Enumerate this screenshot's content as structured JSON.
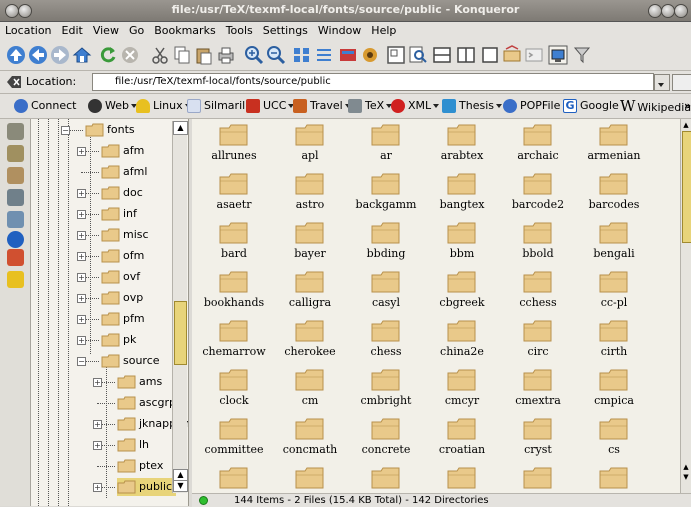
{
  "window": {
    "title": "file:/usr/TeX/texmf-local/fonts/source/public - Konqueror"
  },
  "menu": [
    "Location",
    "Edit",
    "View",
    "Go",
    "Bookmarks",
    "Tools",
    "Settings",
    "Window",
    "Help"
  ],
  "location": {
    "label": "Location:",
    "url": "file:/usr/TeX/texmf-local/fonts/source/public"
  },
  "bookmarks": [
    {
      "label": "Connect",
      "color": "#3a6ec8",
      "dropdown": false
    },
    {
      "label": "Web",
      "color": "#333333",
      "dropdown": true
    },
    {
      "label": "Linux",
      "color": "#e8c020",
      "dropdown": true
    },
    {
      "label": "Silmaril",
      "color": "#9aa8c8",
      "dropdown": true
    },
    {
      "label": "UCC",
      "color": "#c83020",
      "dropdown": true
    },
    {
      "label": "Travel",
      "color": "#c86020",
      "dropdown": true
    },
    {
      "label": "TeX",
      "color": "#808a90",
      "dropdown": true
    },
    {
      "label": "XML",
      "color": "#d02020",
      "dropdown": true
    },
    {
      "label": "Thesis",
      "color": "#2f8fd0",
      "dropdown": true
    },
    {
      "label": "POPFile",
      "color": "#3a6ec8",
      "dropdown": false
    },
    {
      "label": "Google",
      "color": "#2060c0",
      "dropdown": false
    },
    {
      "label": "Wikipedia",
      "color": "#222222",
      "dropdown": false
    }
  ],
  "bookmarks_more": "»",
  "tree": [
    {
      "label": "fonts",
      "depth": 0,
      "expander": "-"
    },
    {
      "label": "afm",
      "depth": 1,
      "expander": "+"
    },
    {
      "label": "afml",
      "depth": 1,
      "expander": ""
    },
    {
      "label": "doc",
      "depth": 1,
      "expander": "+"
    },
    {
      "label": "inf",
      "depth": 1,
      "expander": "+"
    },
    {
      "label": "misc",
      "depth": 1,
      "expander": "+"
    },
    {
      "label": "ofm",
      "depth": 1,
      "expander": "+"
    },
    {
      "label": "ovf",
      "depth": 1,
      "expander": "+"
    },
    {
      "label": "ovp",
      "depth": 1,
      "expander": "+"
    },
    {
      "label": "pfm",
      "depth": 1,
      "expander": "+"
    },
    {
      "label": "pk",
      "depth": 1,
      "expander": "+"
    },
    {
      "label": "source",
      "depth": 1,
      "expander": "-"
    },
    {
      "label": "ams",
      "depth": 2,
      "expander": "+"
    },
    {
      "label": "ascgrp",
      "depth": 2,
      "expander": ""
    },
    {
      "label": "jknappen",
      "depth": 2,
      "expander": "+"
    },
    {
      "label": "lh",
      "depth": 2,
      "expander": "+"
    },
    {
      "label": "ptex",
      "depth": 2,
      "expander": ""
    },
    {
      "label": "public",
      "depth": 2,
      "expander": "+",
      "selected": true
    }
  ],
  "folders": [
    "allrunes",
    "apl",
    "ar",
    "arabtex",
    "archaic",
    "armenian",
    "asaetr",
    "astro",
    "backgamm",
    "bangtex",
    "barcode2",
    "barcodes",
    "bard",
    "bayer",
    "bbding",
    "bbm",
    "bbold",
    "bengali",
    "bookhands",
    "calligra",
    "casyl",
    "cbgreek",
    "cchess",
    "cc-pl",
    "chemarrow",
    "cherokee",
    "chess",
    "china2e",
    "circ",
    "cirth",
    "clock",
    "cm",
    "cmbright",
    "cmcyr",
    "cmextra",
    "cmpica",
    "committee",
    "concmath",
    "concrete",
    "croatian",
    "cryst",
    "cs",
    "",
    "",
    "",
    "",
    "",
    ""
  ],
  "status": "144 Items - 2 Files (15.4 KB Total) - 142 Directories",
  "colors": {
    "folder": "#e9c98a",
    "folder_dark": "#b8914c",
    "selection": "#e8d47a"
  }
}
